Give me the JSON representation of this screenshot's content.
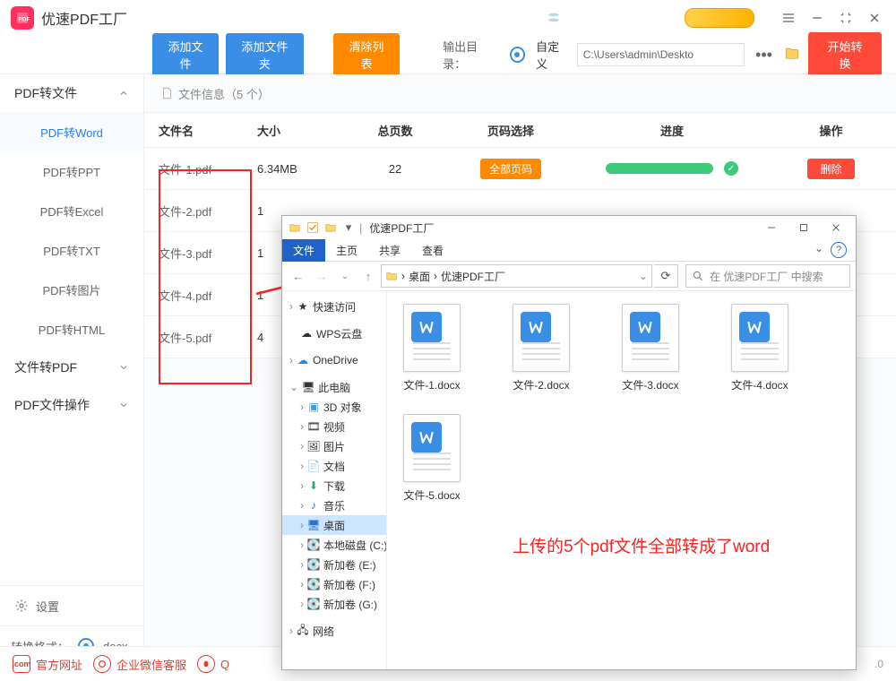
{
  "app": {
    "title": "优速PDF工厂"
  },
  "toolbar": {
    "add_file": "添加文件",
    "add_folder": "添加文件夹",
    "clear": "清除列表",
    "output_label": "输出目录：",
    "custom": "自定义",
    "path": "C:\\Users\\admin\\Deskto",
    "start": "开始转换"
  },
  "sidebar": {
    "group_pdf_to": "PDF转文件",
    "items": [
      "PDF转Word",
      "PDF转PPT",
      "PDF转Excel",
      "PDF转TXT",
      "PDF转图片",
      "PDF转HTML"
    ],
    "group_file_to": "文件转PDF",
    "group_ops": "PDF文件操作",
    "settings": "设置",
    "format_label": "转换格式：",
    "format_value": "docx"
  },
  "info": {
    "label": "文件信息（5 个）"
  },
  "columns": {
    "name": "文件名",
    "size": "大小",
    "pages": "总页数",
    "pagesel": "页码选择",
    "progress": "进度",
    "op": "操作"
  },
  "rows": [
    {
      "name": "文件-1.pdf",
      "size": "6.34MB",
      "pages": "22",
      "pagesel": "全部页码",
      "op": "删除"
    },
    {
      "name": "文件-2.pdf",
      "size": "1"
    },
    {
      "name": "文件-3.pdf",
      "size": "1"
    },
    {
      "name": "文件-4.pdf",
      "size": "1"
    },
    {
      "name": "文件-5.pdf",
      "size": "4"
    }
  ],
  "footer": {
    "site": "官方网址",
    "wecom": "企业微信客服",
    "qq": "Q",
    "ver": ".0"
  },
  "explorer": {
    "title": "优速PDF工厂",
    "tabs": {
      "file": "文件",
      "home": "主页",
      "share": "共享",
      "view": "查看"
    },
    "bread": {
      "sep": "›",
      "desktop": "桌面",
      "folder": "优速PDF工厂"
    },
    "search_placeholder": "在 优速PDF工厂 中搜索",
    "tree": {
      "quick": "快速访问",
      "wps": "WPS云盘",
      "onedrive": "OneDrive",
      "pc": "此电脑",
      "threeD": "3D 对象",
      "video": "视频",
      "pictures": "图片",
      "docs": "文档",
      "downloads": "下载",
      "music": "音乐",
      "desktop": "桌面",
      "local": "本地磁盘 (C:)",
      "vol_e": "新加卷 (E:)",
      "vol_f": "新加卷 (F:)",
      "vol_g": "新加卷 (G:)",
      "net": "网络"
    },
    "files": [
      "文件-1.docx",
      "文件-2.docx",
      "文件-3.docx",
      "文件-4.docx",
      "文件-5.docx"
    ],
    "annotation": "上传的5个pdf文件全部转成了word"
  }
}
